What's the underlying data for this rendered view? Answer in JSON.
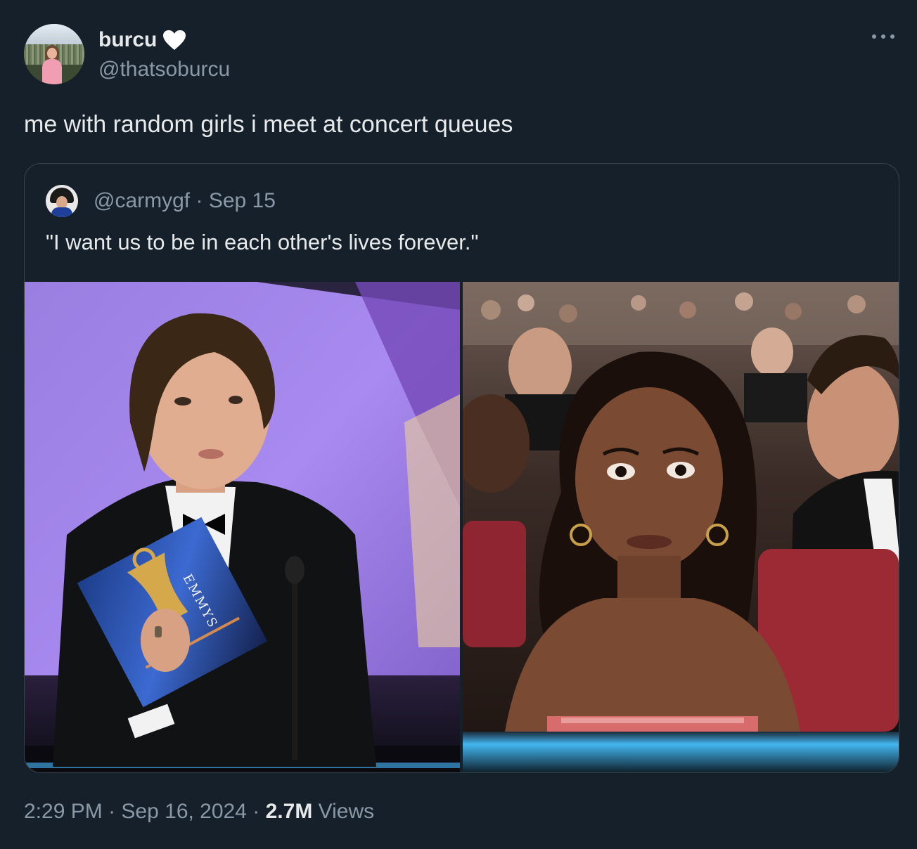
{
  "author": {
    "display_name": "burcu",
    "badge_icon": "heart-icon",
    "handle": "@thatsoburcu"
  },
  "tweet": {
    "text": "me with random girls i meet at concert queues"
  },
  "quoted_tweet": {
    "handle": "@carmygf",
    "separator": "·",
    "date": "Sep 15",
    "text": "\"I want us to be in each other's lives forever.\"",
    "images": [
      {
        "description_icon": "emmys-presenter-photo",
        "card_text": "EMMYS"
      },
      {
        "description_icon": "audience-reaction-photo"
      }
    ]
  },
  "footer": {
    "time": "2:29 PM",
    "separator": "·",
    "date": "Sep 16, 2024",
    "views_count": "2.7M",
    "views_label": "Views"
  },
  "colors": {
    "background": "#15202b",
    "primary_text": "#e7e9ea",
    "secondary_text": "#8b98a5",
    "border": "#38444d"
  }
}
